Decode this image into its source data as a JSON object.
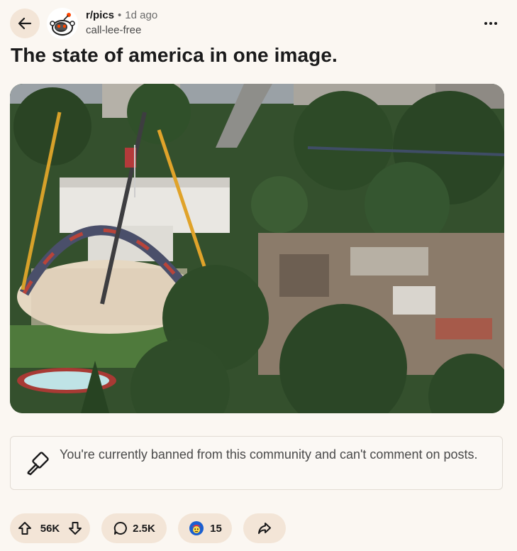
{
  "post": {
    "subreddit": "r/pics",
    "separator": "•",
    "age": "1d ago",
    "author": "call-lee-free",
    "title": "The state of america in one image."
  },
  "notice": {
    "text": "You're currently banned from this community and can't comment on posts."
  },
  "actions": {
    "votes": "56K",
    "comments": "2.5K",
    "awards": "15"
  },
  "icons": {
    "back": "arrow-left-icon",
    "more": "ellipsis-horizontal-icon",
    "ban": "hammer-icon",
    "upvote": "arrow-up-icon",
    "downvote": "arrow-down-icon",
    "comment": "speech-bubble-icon",
    "award": "award-face-icon",
    "share": "share-arrow-icon"
  },
  "colors": {
    "background": "#fbf7f2",
    "button_bg": "#f3e5d7",
    "text": "#1a1a1b",
    "muted": "#6b6b6b"
  }
}
